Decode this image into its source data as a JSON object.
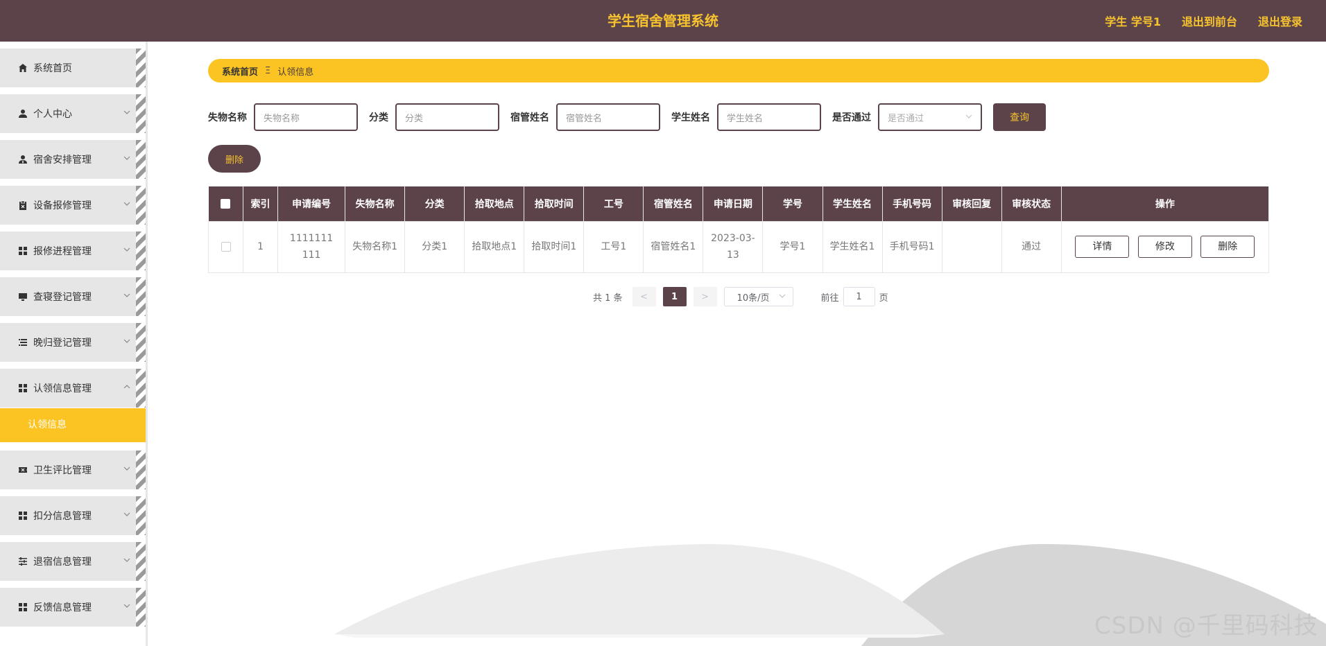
{
  "header": {
    "title": "学生宿舍管理系统",
    "user_label": "学生 学号1",
    "front_label": "退出到前台",
    "logout_label": "退出登录"
  },
  "sidebar": {
    "items": [
      {
        "label": "系统首页",
        "icon": "home-icon",
        "has_arrow": false
      },
      {
        "label": "个人中心",
        "icon": "user-icon",
        "has_arrow": true
      },
      {
        "label": "宿舍安排管理",
        "icon": "user-tie-icon",
        "has_arrow": true
      },
      {
        "label": "设备报修管理",
        "icon": "clipboard-icon",
        "has_arrow": true
      },
      {
        "label": "报修进程管理",
        "icon": "grid-icon",
        "has_arrow": true
      },
      {
        "label": "查寝登记管理",
        "icon": "monitor-icon",
        "has_arrow": true
      },
      {
        "label": "晚归登记管理",
        "icon": "list-icon",
        "has_arrow": true
      },
      {
        "label": "认领信息管理",
        "icon": "grid-icon",
        "has_arrow": true,
        "expanded": true
      },
      {
        "label": "卫生评比管理",
        "icon": "ticket-icon",
        "has_arrow": true
      },
      {
        "label": "扣分信息管理",
        "icon": "grid-icon",
        "has_arrow": true
      },
      {
        "label": "退宿信息管理",
        "icon": "sliders-icon",
        "has_arrow": true
      },
      {
        "label": "反馈信息管理",
        "icon": "grid-icon",
        "has_arrow": true
      }
    ],
    "active_sub": "认领信息"
  },
  "breadcrumb": {
    "home": "系统首页",
    "separator": "Ξ",
    "current": "认领信息"
  },
  "search": {
    "fields": [
      {
        "label": "失物名称",
        "placeholder": "失物名称"
      },
      {
        "label": "分类",
        "placeholder": "分类"
      },
      {
        "label": "宿管姓名",
        "placeholder": "宿管姓名"
      },
      {
        "label": "学生姓名",
        "placeholder": "学生姓名"
      }
    ],
    "select": {
      "label": "是否通过",
      "placeholder": "是否通过"
    },
    "query_label": "查询"
  },
  "actions": {
    "delete_label": "删除"
  },
  "table": {
    "headers": [
      "索引",
      "申请编号",
      "失物名称",
      "分类",
      "拾取地点",
      "拾取时间",
      "工号",
      "宿管姓名",
      "申请日期",
      "学号",
      "学生姓名",
      "手机号码",
      "审核回复",
      "审核状态",
      "操作"
    ],
    "rows": [
      {
        "index": "1",
        "apply_no": "1111111111",
        "item_name": "失物名称1",
        "category": "分类1",
        "pickup_place": "拾取地点1",
        "pickup_time": "拾取时间1",
        "staff_no": "工号1",
        "manager_name": "宿管姓名1",
        "apply_date": "2023-03-13",
        "student_no": "学号1",
        "student_name": "学生姓名1",
        "phone": "手机号码1",
        "reply": "",
        "status": "通过",
        "ops": [
          "详情",
          "修改",
          "删除"
        ]
      }
    ]
  },
  "pagination": {
    "total_text": "共 1 条",
    "prev": "<",
    "current": "1",
    "next": ">",
    "page_size": "10条/页",
    "goto_label": "前往",
    "goto_value": "1",
    "page_suffix": "页"
  },
  "watermark": "CSDN @千里码科技",
  "colors": {
    "primary": "#5c434a",
    "accent": "#fbc422",
    "text_accent": "#f7c32e"
  }
}
